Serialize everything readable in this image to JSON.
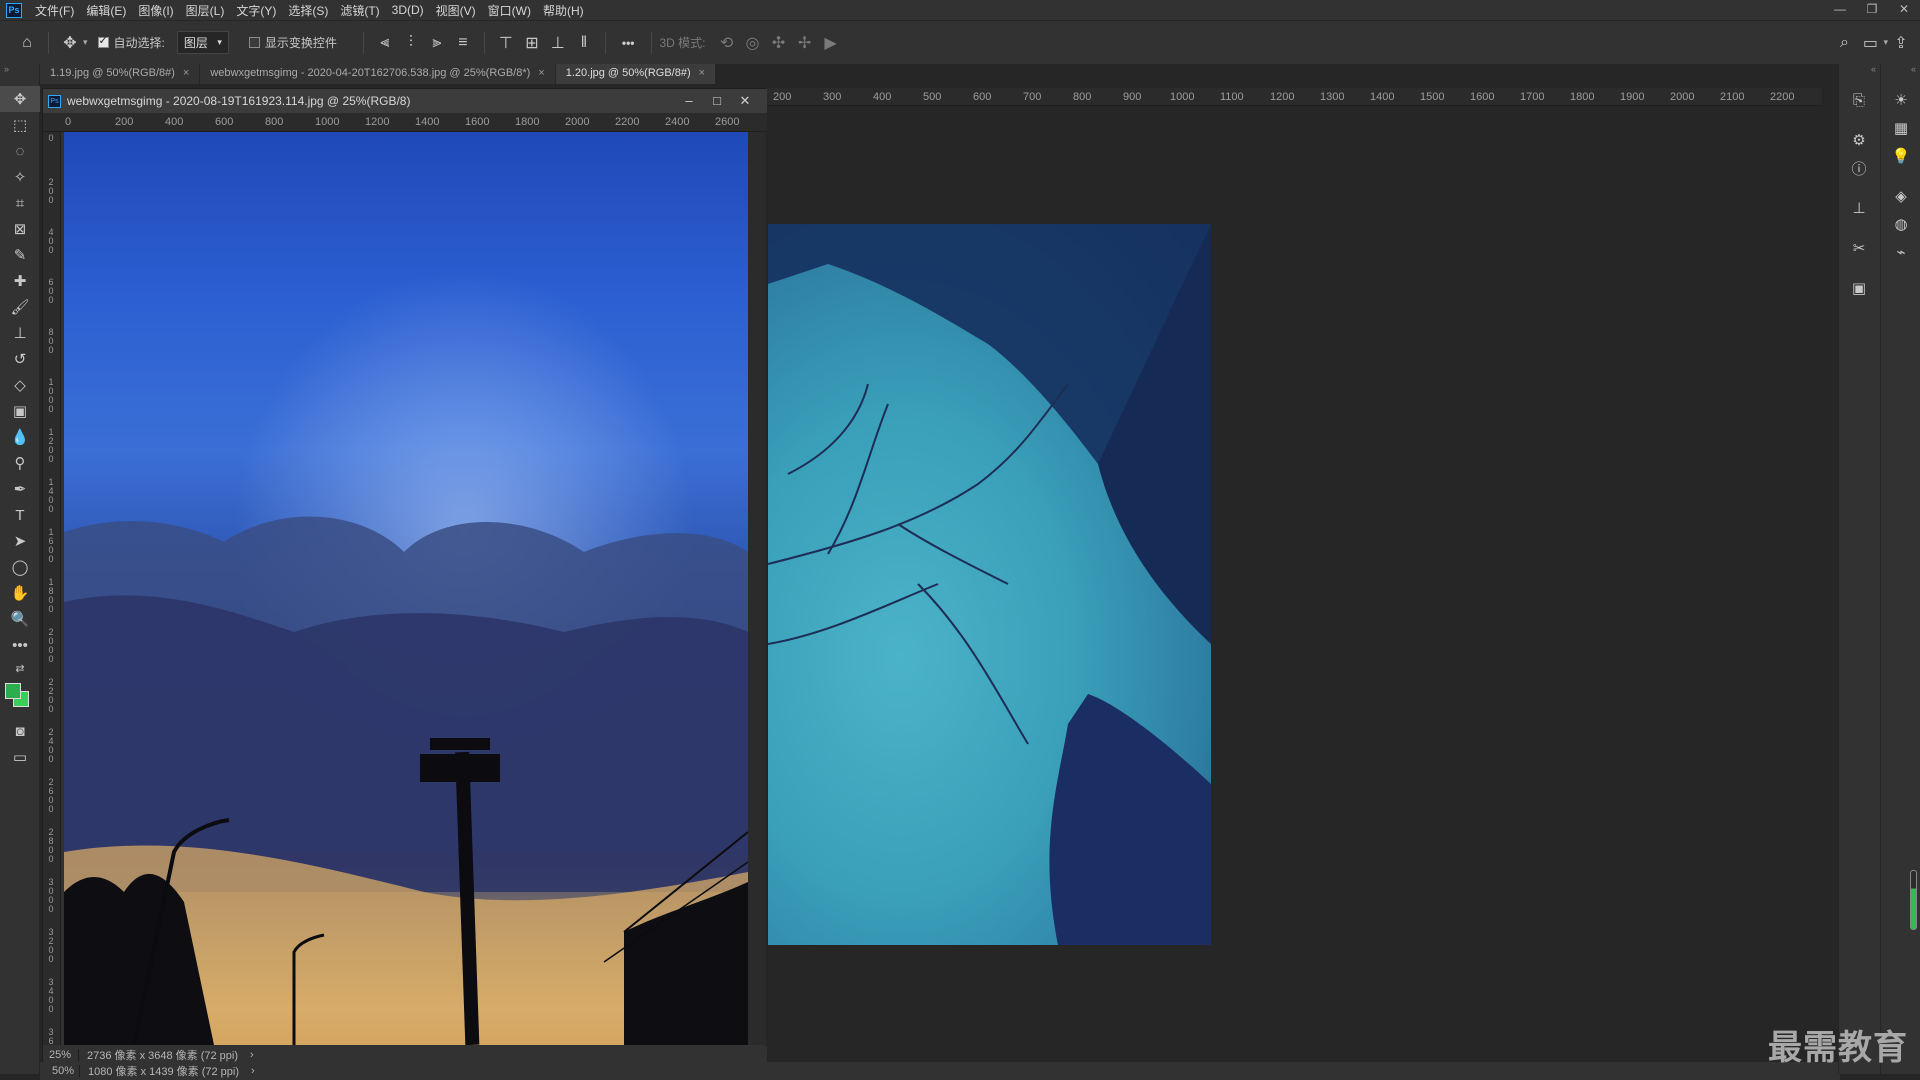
{
  "app": {
    "logo": "Ps"
  },
  "menu": [
    "文件(F)",
    "编辑(E)",
    "图像(I)",
    "图层(L)",
    "文字(Y)",
    "选择(S)",
    "滤镜(T)",
    "3D(D)",
    "视图(V)",
    "窗口(W)",
    "帮助(H)"
  ],
  "window_controls": {
    "minimize": "—",
    "restore": "❐",
    "close": "✕"
  },
  "options_bar": {
    "auto_select_label": "自动选择:",
    "auto_select_checked": true,
    "layer_dropdown": "图层",
    "show_transform_label": "显示变换控件",
    "more": "•••",
    "mode_3d_label": "3D 模式:"
  },
  "tabs": [
    {
      "label": "1.19.jpg @ 50%(RGB/8#)",
      "close": "×"
    },
    {
      "label": "webwxgetmsgimg - 2020-04-20T162706.538.jpg @ 25%(RGB/8*)",
      "close": "×"
    },
    {
      "label": "1.20.jpg @ 50%(RGB/8#)",
      "close": "×"
    }
  ],
  "floating_doc": {
    "title": "webwxgetmsgimg - 2020-08-19T161923.114.jpg @ 25%(RGB/8)",
    "ruler_h": [
      "0",
      "200",
      "400",
      "600",
      "800",
      "1000",
      "1200",
      "1400",
      "1600",
      "1800",
      "2000",
      "2200",
      "2400",
      "2600"
    ],
    "ruler_v": [
      "0",
      "2 0 0",
      "4 0 0",
      "6 0 0",
      "8 0 0",
      "1 0 0 0",
      "1 2 0 0",
      "1 4 0 0",
      "1 6 0 0",
      "1 8 0 0",
      "2 0 0 0",
      "2 2 0 0",
      "2 4 0 0",
      "2 6 0 0",
      "2 8 0 0",
      "3 0 0 0",
      "3 2 0 0",
      "3 4 0 0",
      "3 6"
    ],
    "zoom": "25%",
    "doc_info": "2736 像素 x 3648 像素 (72 ppi)",
    "arrow": "›"
  },
  "canvas_ruler": [
    "200",
    "300",
    "400",
    "500",
    "600",
    "700",
    "800",
    "900",
    "1000",
    "1100",
    "1200",
    "1300",
    "1400",
    "1500",
    "1600",
    "1700",
    "1800",
    "1900",
    "2000",
    "2100",
    "2200"
  ],
  "main_status": {
    "zoom": "50%",
    "doc_info": "1080 像素 x 1439 像素 (72 ppi)",
    "arrow": "›"
  },
  "colors": {
    "foreground": "#2dae4d",
    "background": "#38d158",
    "accent": "#31a8ff"
  },
  "watermark": "最需教育"
}
